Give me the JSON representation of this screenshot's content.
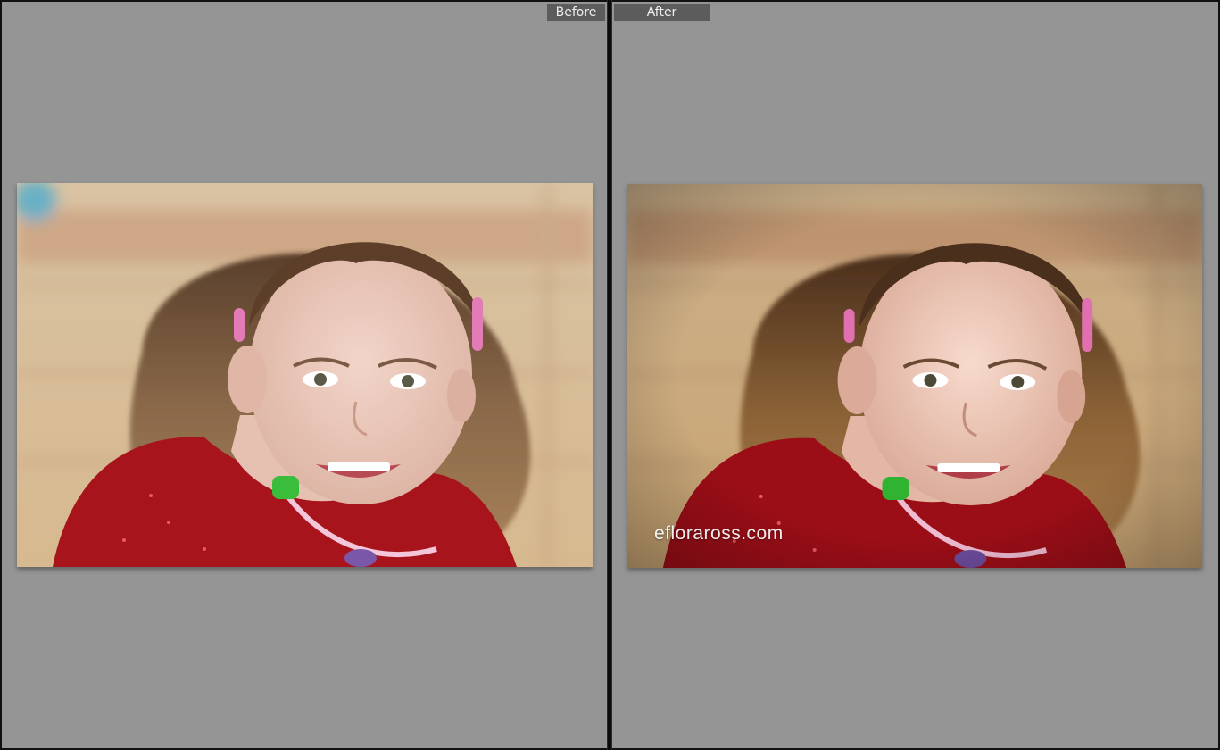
{
  "app": {
    "view": "before-after-compare"
  },
  "before_pane": {
    "label": "Before",
    "background_color": "#959595"
  },
  "after_pane": {
    "label": "After",
    "background_color": "#959595",
    "watermark": "efloraross.com"
  },
  "colors": {
    "tab_bg": "#5c5c5c",
    "tab_text": "#eeeeee",
    "divider": "#0b0b0b"
  },
  "photo": {
    "subject": "portrait-girl-red-shirt",
    "before_tone": "flat",
    "after_tone": "warm-vignette"
  }
}
